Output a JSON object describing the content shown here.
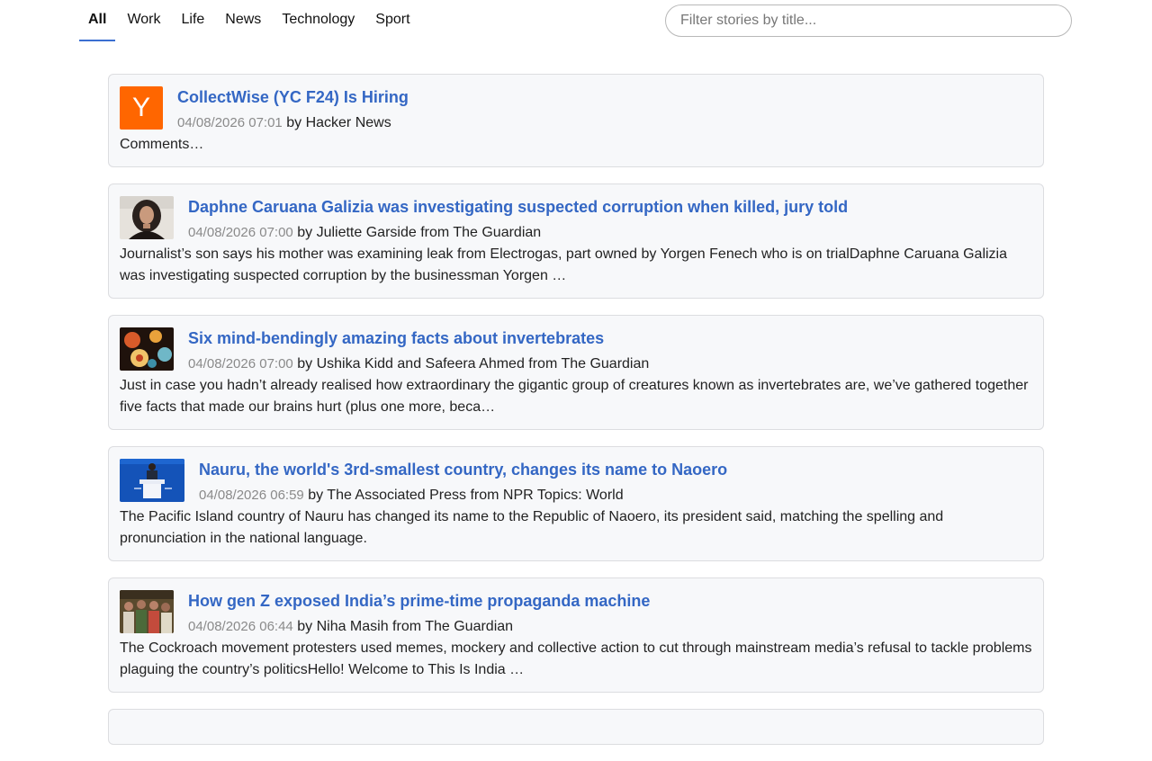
{
  "nav": {
    "tabs": [
      {
        "label": "All",
        "active": true
      },
      {
        "label": "Work",
        "active": false
      },
      {
        "label": "Life",
        "active": false
      },
      {
        "label": "News",
        "active": false
      },
      {
        "label": "Technology",
        "active": false
      },
      {
        "label": "Sport",
        "active": false
      }
    ]
  },
  "filter": {
    "placeholder": "Filter stories by title...",
    "value": ""
  },
  "stories": [
    {
      "title": "CollectWise (YC F24) Is Hiring",
      "date": "04/08/2026 07:01",
      "byline": "by Hacker News",
      "summary": "Comments…",
      "thumb_icon": "hacker-news-logo",
      "thumb_letter": "Y"
    },
    {
      "title": "Daphne Caruana Galizia was investigating suspected corruption when killed, jury told",
      "date": "04/08/2026 07:00",
      "byline": "by Juliette Garside from The Guardian",
      "summary": "Journalist’s son says his mother was examining leak from Electrogas, part owned by Yorgen Fenech who is on trialDaphne Caruana Galizia was investigating suspected corruption by the businessman Yorgen …",
      "thumb_icon": "portrait-photo"
    },
    {
      "title": "Six mind-bendingly amazing facts about invertebrates",
      "date": "04/08/2026 07:00",
      "byline": "by Ushika Kidd and Safeera Ahmed from The Guardian",
      "summary": "Just in case you hadn’t already realised how extraordinary the gigantic group of creatures known as invertebrates are, we’ve gathered together five facts that made our brains hurt (plus one more, beca…",
      "thumb_icon": "jellyfish-photo"
    },
    {
      "title": "Nauru, the world's 3rd-smallest country, changes its name to Naoero",
      "date": "04/08/2026 06:59",
      "byline": "by The Associated Press from NPR Topics: World",
      "summary": "The Pacific Island country of Nauru has changed its name to the Republic of Naoero, its president said, matching the spelling and pronunciation in the national language.",
      "thumb_icon": "podium-photo"
    },
    {
      "title": "How gen Z exposed India’s prime-time propaganda machine",
      "date": "04/08/2026 06:44",
      "byline": "by Niha Masih from The Guardian",
      "summary": "The Cockroach movement protesters used memes, mockery and collective action to cut through mainstream media’s refusal to tackle problems plaguing the country’s politicsHello! Welcome to This Is India …",
      "thumb_icon": "crowd-photo"
    }
  ]
}
